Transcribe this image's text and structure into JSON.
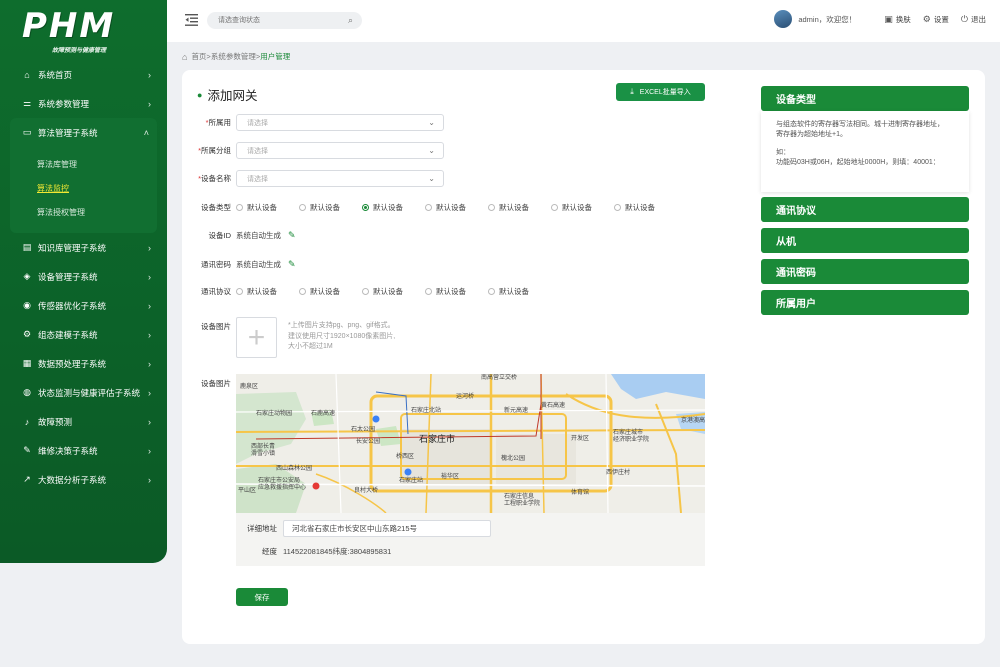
{
  "logo": {
    "title": "PHM",
    "subtitle": "故障预测与健康管理"
  },
  "sidebar": {
    "items": [
      {
        "label": "系统首页",
        "icon": "home-icon"
      },
      {
        "label": "系统参数管理",
        "icon": "sliders-icon"
      },
      {
        "label": "算法管理子系统",
        "icon": "monitor-icon",
        "open": true,
        "children": [
          {
            "label": "算法库管理"
          },
          {
            "label": "算法监控",
            "active": true
          },
          {
            "label": "算法授权管理"
          }
        ]
      },
      {
        "label": "知识库管理子系统",
        "icon": "book-icon"
      },
      {
        "label": "设备管理子系统",
        "icon": "layers-icon"
      },
      {
        "label": "传感器优化子系统",
        "icon": "signal-icon"
      },
      {
        "label": "组态建模子系统",
        "icon": "gear-icon"
      },
      {
        "label": "数据预处理子系统",
        "icon": "grid-icon"
      },
      {
        "label": "状态监测与健康评估子系统",
        "icon": "dashboard-icon"
      },
      {
        "label": "故障预测",
        "icon": "bell-icon"
      },
      {
        "label": "维修决策子系统",
        "icon": "wrench-icon"
      },
      {
        "label": "大数据分析子系统",
        "icon": "chart-icon"
      }
    ]
  },
  "topbar": {
    "search_placeholder": "请选查询状态",
    "welcome": "admin，欢迎您！",
    "buttons": [
      {
        "label": "换肤",
        "icon": "skin-icon"
      },
      {
        "label": "设置",
        "icon": "settings-icon"
      },
      {
        "label": "退出",
        "icon": "logout-icon"
      }
    ]
  },
  "breadcrumb": {
    "path": "首页>系统参数管理>",
    "current": "用户管理"
  },
  "form": {
    "title": "添加网关",
    "excel_button": "EXCEL批量导入",
    "owner_label": "所属用户",
    "owner_label_visible": "所属用",
    "group_label": "所属分组",
    "device_name_label": "设备名称",
    "select_placeholder": "请选择",
    "device_type_label": "设备类型",
    "device_type_options": [
      "默认设备",
      "默认设备",
      "默认设备",
      "默认设备",
      "默认设备",
      "默认设备",
      "默认设备"
    ],
    "device_type_selected": 2,
    "device_id_label": "设备ID",
    "device_id_value": "系统自动生成",
    "comm_password_label": "通讯密码",
    "comm_password_value": "系统自动生成",
    "protocol_label": "通讯协议",
    "protocol_options": [
      "默认设备",
      "默认设备",
      "默认设备",
      "默认设备",
      "默认设备"
    ],
    "image_label": "设备图片",
    "upload_tip": [
      "*上传图片支持pg、png、gif格式。",
      "建议使用尺寸1920×1080像素图片,",
      "大小不超过1M"
    ],
    "map_label": "设备图片",
    "address_label": "详细地址",
    "address_value": "河北省石家庄市长安区中山东路215号",
    "coord_label": "经度",
    "coord_value": "114522081845纬度:3804895831",
    "save_button": "保存"
  },
  "map": {
    "labels": [
      "鹿泉区",
      "南高营立交桥",
      "运河桥",
      "石家庄动物园",
      "石家庄北站",
      "石鹿高速",
      "新元高速",
      "黄石高速",
      "京港澳高速",
      "石太公园",
      "石家庄市",
      "长安公园",
      "开发区",
      "石家庄城市经济职业学院",
      "西部长青滑雪小镇",
      "西山森林公园",
      "桥西区",
      "槐北公园",
      "石家庄市公安局应急救援指挥中心",
      "石家庄站",
      "良村大桥",
      "裕华区",
      "石家庄信息工程职业学院",
      "西伊庄村",
      "体育馆",
      "平山区"
    ],
    "road_color": "#f6c548",
    "water_color": "#a9cdf2",
    "park_color": "#c8e6c0"
  },
  "right_panel": {
    "sections": [
      {
        "title": "设备类型",
        "expanded": true,
        "body": [
          "与组态软件的寄存器写法相同。城十进制寄存器地址，",
          "寄存器为超始地址+1。",
          "",
          "如：",
          "功能码03H或06H，起始地址0000H，则填：40001："
        ]
      },
      {
        "title": "通讯协议"
      },
      {
        "title": "从机"
      },
      {
        "title": "通讯密码"
      },
      {
        "title": "所属用户"
      }
    ]
  },
  "colors": {
    "brand_green": "#1a8a38",
    "sidebar": "#0e6d2d",
    "active_sub": "#f2e833"
  }
}
